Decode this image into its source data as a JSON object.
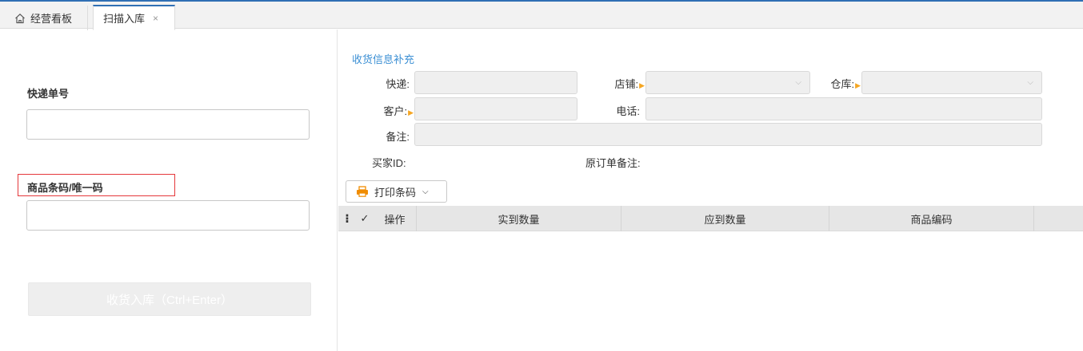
{
  "tabs": [
    {
      "label": "经营看板"
    },
    {
      "label": "扫描入库",
      "close": "×"
    }
  ],
  "left": {
    "express_label": "快递单号",
    "barcode_label": "商品条码/唯一码",
    "receive_button": "收货入库（Ctrl+Enter）"
  },
  "form": {
    "section_title": "收货信息补充",
    "express_label": "快递:",
    "shop_label": "店铺:",
    "warehouse_label": "仓库:",
    "customer_label": "客户:",
    "phone_label": "电话:",
    "remark_label": "备注:",
    "buyer_id_label": "买家ID:",
    "orig_remark_label": "原订单备注:"
  },
  "toolbar": {
    "print_button": "打印条码"
  },
  "grid": {
    "menu_glyph": "⁝",
    "check_glyph": "✓",
    "columns": [
      "操作",
      "实到数量",
      "应到数量",
      "商品编码"
    ]
  },
  "colors": {
    "accent": "#2f6fb4",
    "section_title": "#3b8fd4",
    "required_marker": "#f5a623",
    "highlight_border": "#e5383b",
    "print_icon": "#f08c00"
  }
}
